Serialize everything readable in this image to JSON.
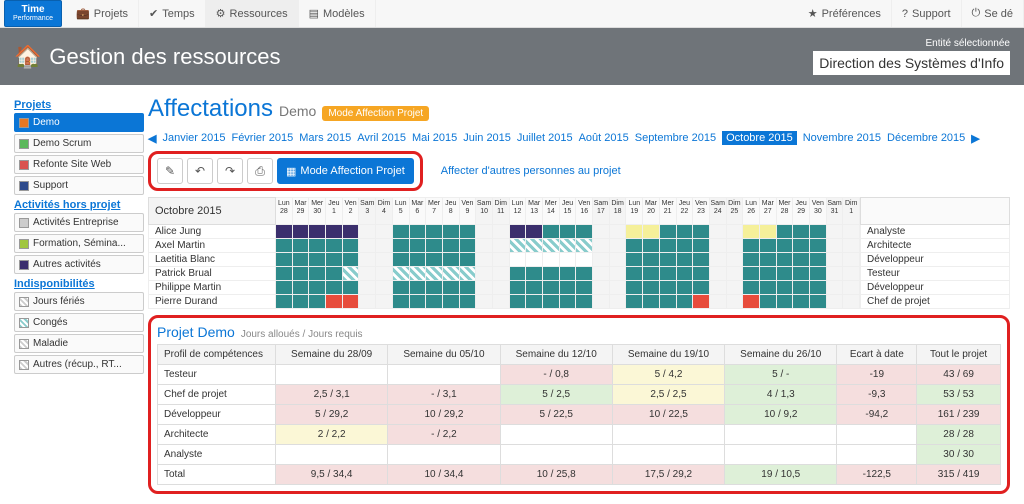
{
  "app": {
    "logo_top": "Time",
    "logo_sub": "Performance"
  },
  "topnav": {
    "items": [
      "Projets",
      "Temps",
      "Ressources",
      "Modèles"
    ],
    "right": [
      "Préférences",
      "Support",
      "Se dé"
    ]
  },
  "header": {
    "title": "Gestion des ressources",
    "entity_label": "Entité sélectionnée",
    "entity_value": "Direction des Systèmes d'Info"
  },
  "page": {
    "title": "Affectations",
    "subtitle": "Demo",
    "badge": "Mode Affection Projet"
  },
  "sidebar": {
    "projects_h": "Projets",
    "projects": [
      {
        "label": "Demo",
        "color": "orange",
        "selected": true
      },
      {
        "label": "Demo Scrum",
        "color": "green"
      },
      {
        "label": "Refonte Site Web",
        "color": "red"
      },
      {
        "label": "Support",
        "color": "darkblue"
      }
    ],
    "acts_h": "Activités hors projet",
    "acts": [
      {
        "label": "Activités Entreprise",
        "color": "grey"
      },
      {
        "label": "Formation, Sémina...",
        "color": "ygreen"
      },
      {
        "label": "Autres activités",
        "color": "purple"
      }
    ],
    "indispo_h": "Indisponibilités",
    "indispo": [
      {
        "label": "Jours fériés",
        "color": "hatchg"
      },
      {
        "label": "Congés",
        "color": "hatch"
      },
      {
        "label": "Maladie",
        "color": "hatchg"
      },
      {
        "label": "Autres (récup., RT...",
        "color": "hatchg"
      }
    ]
  },
  "months": {
    "year": "2015",
    "list": [
      "Janvier 2015",
      "Février 2015",
      "Mars 2015",
      "Avril 2015",
      "Mai 2015",
      "Juin 2015",
      "Juillet 2015",
      "Août 2015",
      "Septembre 2015",
      "Octobre 2015",
      "Novembre 2015",
      "Décembre 2015"
    ],
    "selected": 9
  },
  "toolbar": {
    "mode": "Mode Affection Projet",
    "affect_link": "Affecter d'autres personnes au projet"
  },
  "gantt": {
    "month_label": "Octobre 2015",
    "dows": [
      "Lun",
      "Mar",
      "Mer",
      "Jeu",
      "Ven",
      "Sam",
      "Dim",
      "Lun",
      "Mar",
      "Mer",
      "Jeu",
      "Ven",
      "Sam",
      "Dim",
      "Lun",
      "Mar",
      "Mer",
      "Jeu",
      "Ven",
      "Sam",
      "Dim",
      "Lun",
      "Mar",
      "Mer",
      "Jeu",
      "Ven",
      "Sam",
      "Dim",
      "Lun",
      "Mar",
      "Mer",
      "Jeu",
      "Ven",
      "Sam",
      "Dim"
    ],
    "nums": [
      "28",
      "29",
      "30",
      "1",
      "2",
      "3",
      "4",
      "5",
      "6",
      "7",
      "8",
      "9",
      "10",
      "11",
      "12",
      "13",
      "14",
      "15",
      "16",
      "17",
      "18",
      "19",
      "20",
      "21",
      "22",
      "23",
      "24",
      "25",
      "26",
      "27",
      "28",
      "29",
      "30",
      "31",
      "1"
    ],
    "people": [
      {
        "name": "Alice Jung",
        "role": "Analyste",
        "cells": "DDDDDwwTTTTTwwDDTTTwwYYTTTwwYYTTTww"
      },
      {
        "name": "Axel Martin",
        "role": "Architecte",
        "cells": "TTTTTwwTTTTTwwHHHHHwwTTTTTwwTTTTTww"
      },
      {
        "name": "Laetitia Blanc",
        "role": "Développeur",
        "cells": "TTTTTwwTTTTTww.....wwTTTTTwwTTTTTww"
      },
      {
        "name": "Patrick Brual",
        "role": "Testeur",
        "cells": "TTTTHwwHHHHHwwTTTTTwwTTTTTwwTTTTTww"
      },
      {
        "name": "Philippe Martin",
        "role": "Développeur",
        "cells": "TTTTTwwTTTTTwwTTTTTwwTTTTTwwTTTTTww"
      },
      {
        "name": "Pierre Durand",
        "role": "Chef de projet",
        "cells": "TTTRRwwTTTTTwwTTTTTwwTTTTRwwRTTTTww"
      }
    ]
  },
  "demo": {
    "title": "Projet Demo",
    "subtitle": "Jours alloués / Jours requis",
    "headers": [
      "Profil de compétences",
      "Semaine du 28/09",
      "Semaine du 05/10",
      "Semaine du 12/10",
      "Semaine du 19/10",
      "Semaine du 26/10",
      "Ecart à date",
      "Tout le projet"
    ],
    "rows": [
      {
        "label": "Testeur",
        "cells": [
          {
            "v": ""
          },
          {
            "v": ""
          },
          {
            "v": "- / 0,8",
            "c": "pink"
          },
          {
            "v": "5 / 4,2",
            "c": "yel"
          },
          {
            "v": "5 / -",
            "c": "grn"
          },
          {
            "v": "-19",
            "c": "pink"
          },
          {
            "v": "43 / 69",
            "c": "pink"
          }
        ]
      },
      {
        "label": "Chef de projet",
        "cells": [
          {
            "v": "2,5 / 3,1",
            "c": "pink"
          },
          {
            "v": "- / 3,1",
            "c": "pink"
          },
          {
            "v": "5 / 2,5",
            "c": "grn"
          },
          {
            "v": "2,5 / 2,5",
            "c": "yel"
          },
          {
            "v": "4 / 1,3",
            "c": "grn"
          },
          {
            "v": "-9,3",
            "c": "pink"
          },
          {
            "v": "53 / 53",
            "c": "grn"
          }
        ]
      },
      {
        "label": "Développeur",
        "cells": [
          {
            "v": "5 / 29,2",
            "c": "pink"
          },
          {
            "v": "10 / 29,2",
            "c": "pink"
          },
          {
            "v": "5 / 22,5",
            "c": "pink"
          },
          {
            "v": "10 / 22,5",
            "c": "pink"
          },
          {
            "v": "10 / 9,2",
            "c": "grn"
          },
          {
            "v": "-94,2",
            "c": "pink"
          },
          {
            "v": "161 / 239",
            "c": "pink"
          }
        ]
      },
      {
        "label": "Architecte",
        "cells": [
          {
            "v": "2 / 2,2",
            "c": "yel"
          },
          {
            "v": "- / 2,2",
            "c": "pink"
          },
          {
            "v": ""
          },
          {
            "v": ""
          },
          {
            "v": ""
          },
          {
            "v": ""
          },
          {
            "v": "28 / 28",
            "c": "grn"
          }
        ]
      },
      {
        "label": "Analyste",
        "cells": [
          {
            "v": ""
          },
          {
            "v": ""
          },
          {
            "v": ""
          },
          {
            "v": ""
          },
          {
            "v": ""
          },
          {
            "v": ""
          },
          {
            "v": "30 / 30",
            "c": "grn"
          }
        ]
      },
      {
        "label": "Total",
        "cells": [
          {
            "v": "9,5 / 34,4",
            "c": "pink"
          },
          {
            "v": "10 / 34,4",
            "c": "pink"
          },
          {
            "v": "10 / 25,8",
            "c": "pink"
          },
          {
            "v": "17,5 / 29,2",
            "c": "pink"
          },
          {
            "v": "19 / 10,5",
            "c": "grn"
          },
          {
            "v": "-122,5",
            "c": "pink"
          },
          {
            "v": "315 / 419",
            "c": "pink"
          }
        ]
      }
    ]
  }
}
